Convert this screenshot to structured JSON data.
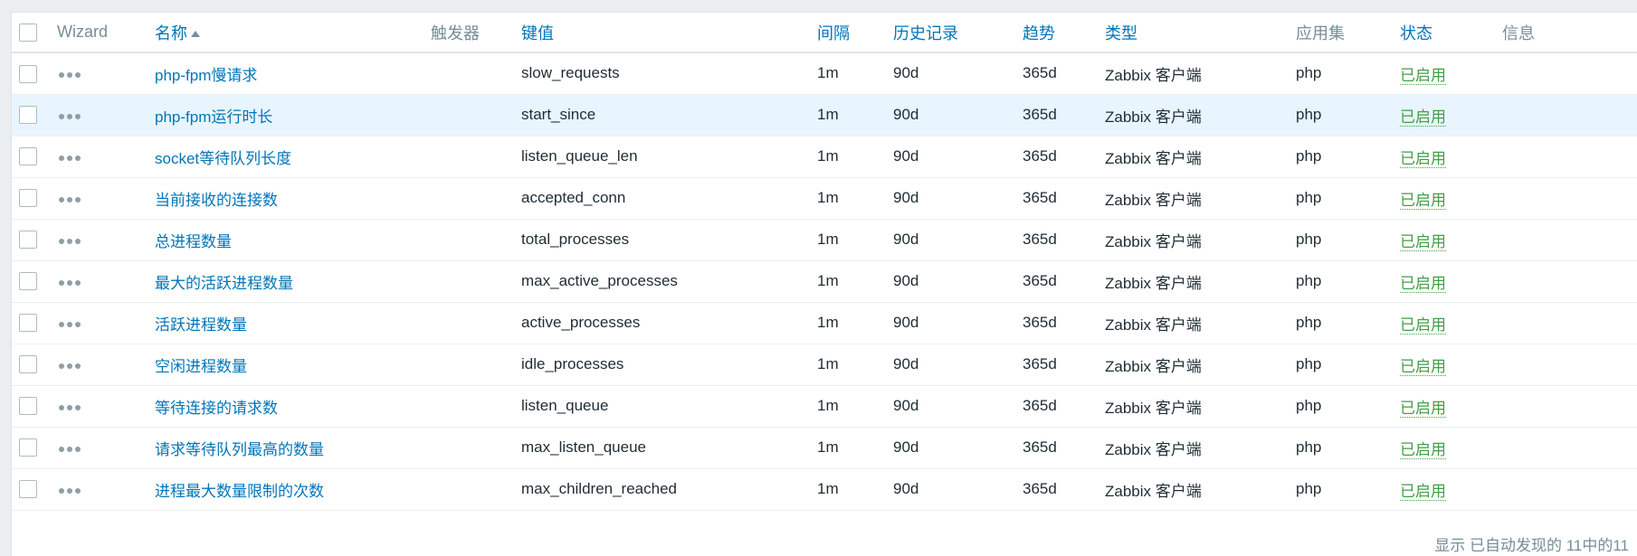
{
  "table": {
    "headers": {
      "wizard": "Wizard",
      "name": "名称",
      "triggers": "触发器",
      "key": "键值",
      "interval": "间隔",
      "history": "历史记录",
      "trends": "趋势",
      "type": "类型",
      "applications": "应用集",
      "status": "状态",
      "info": "信息"
    },
    "rows": [
      {
        "name": "php-fpm慢请求",
        "key": "slow_requests",
        "interval": "1m",
        "history": "90d",
        "trends": "365d",
        "type": "Zabbix 客户端",
        "application": "php",
        "status": "已启用"
      },
      {
        "name": "php-fpm运行时长",
        "key": "start_since",
        "interval": "1m",
        "history": "90d",
        "trends": "365d",
        "type": "Zabbix 客户端",
        "application": "php",
        "status": "已启用"
      },
      {
        "name": "socket等待队列长度",
        "key": "listen_queue_len",
        "interval": "1m",
        "history": "90d",
        "trends": "365d",
        "type": "Zabbix 客户端",
        "application": "php",
        "status": "已启用"
      },
      {
        "name": "当前接收的连接数",
        "key": "accepted_conn",
        "interval": "1m",
        "history": "90d",
        "trends": "365d",
        "type": "Zabbix 客户端",
        "application": "php",
        "status": "已启用"
      },
      {
        "name": "总进程数量",
        "key": "total_processes",
        "interval": "1m",
        "history": "90d",
        "trends": "365d",
        "type": "Zabbix 客户端",
        "application": "php",
        "status": "已启用"
      },
      {
        "name": "最大的活跃进程数量",
        "key": "max_active_processes",
        "interval": "1m",
        "history": "90d",
        "trends": "365d",
        "type": "Zabbix 客户端",
        "application": "php",
        "status": "已启用"
      },
      {
        "name": "活跃进程数量",
        "key": "active_processes",
        "interval": "1m",
        "history": "90d",
        "trends": "365d",
        "type": "Zabbix 客户端",
        "application": "php",
        "status": "已启用"
      },
      {
        "name": "空闲进程数量",
        "key": "idle_processes",
        "interval": "1m",
        "history": "90d",
        "trends": "365d",
        "type": "Zabbix 客户端",
        "application": "php",
        "status": "已启用"
      },
      {
        "name": "等待连接的请求数",
        "key": "listen_queue",
        "interval": "1m",
        "history": "90d",
        "trends": "365d",
        "type": "Zabbix 客户端",
        "application": "php",
        "status": "已启用"
      },
      {
        "name": "请求等待队列最高的数量",
        "key": "max_listen_queue",
        "interval": "1m",
        "history": "90d",
        "trends": "365d",
        "type": "Zabbix 客户端",
        "application": "php",
        "status": "已启用"
      },
      {
        "name": "进程最大数量限制的次数",
        "key": "max_children_reached",
        "interval": "1m",
        "history": "90d",
        "trends": "365d",
        "type": "Zabbix 客户端",
        "application": "php",
        "status": "已启用"
      }
    ]
  },
  "footer": {
    "summary": "显示 已自动发现的 11中的11"
  },
  "colors": {
    "link": "#0275b8",
    "status_enabled": "#429e47",
    "hover_row": "#e8f5ff",
    "header_muted": "#768d99"
  },
  "icons": {
    "row_menu": "more-dots-icon",
    "sort": "sort-ascending-icon"
  }
}
